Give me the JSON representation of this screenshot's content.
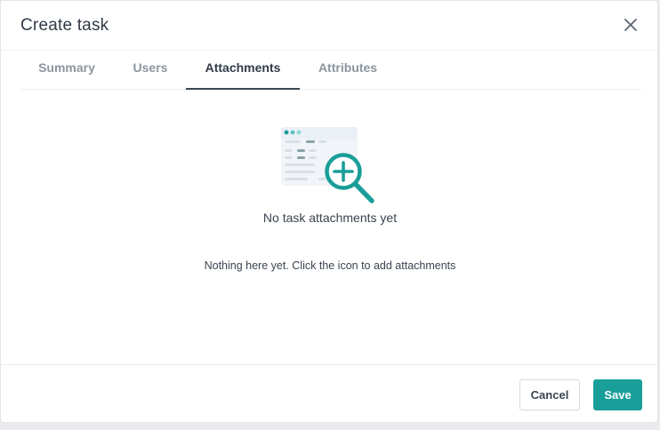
{
  "dialog": {
    "title": "Create task",
    "close_icon": "close-icon"
  },
  "tabs": [
    {
      "label": "Summary",
      "active": false
    },
    {
      "label": "Users",
      "active": false
    },
    {
      "label": "Attachments",
      "active": true
    },
    {
      "label": "Attributes",
      "active": false
    }
  ],
  "empty_state": {
    "illustration_icon": "add-attachment-magnifier-icon",
    "title": "No task attachments yet",
    "description": "Nothing here yet. Click the icon to add attachments"
  },
  "footer": {
    "cancel_label": "Cancel",
    "save_label": "Save"
  },
  "colors": {
    "accent": "#1a9e99",
    "tab_active_underline": "#3a4652"
  }
}
